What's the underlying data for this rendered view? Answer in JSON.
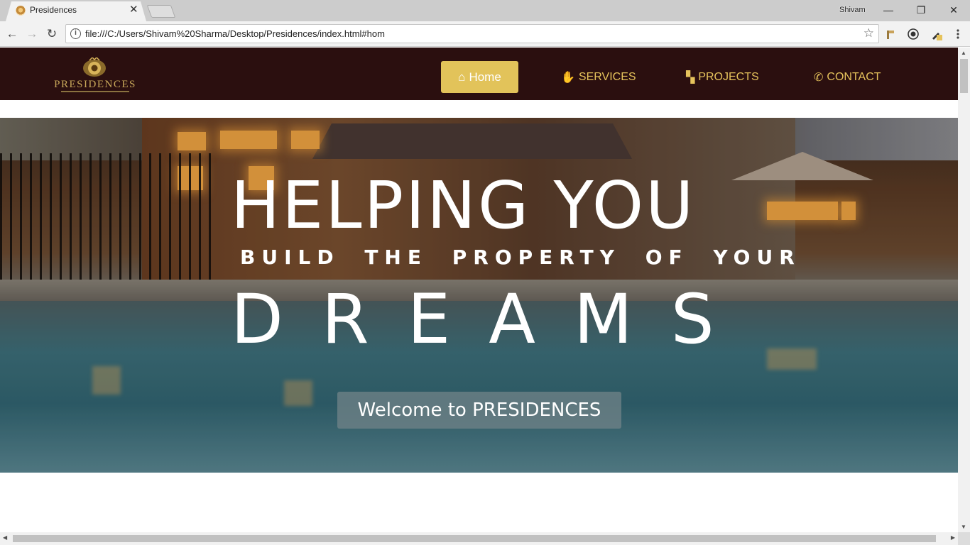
{
  "browser": {
    "tab_title": "Presidences",
    "tab_close": "✕",
    "profile_name": "Shivam",
    "window_controls": {
      "minimize": "—",
      "maximize": "❐",
      "close": "✕"
    },
    "url": "file:///C:/Users/Shivam%20Sharma/Desktop/Presidences/index.html#hom",
    "nav": {
      "back": "←",
      "forward": "→",
      "reload": "↻"
    },
    "bookmark_star": "☆",
    "info_icon": "i"
  },
  "site": {
    "logo_text": "PRESIDENCES",
    "menu": [
      {
        "label": "Home",
        "icon": "home-icon",
        "glyph": "⌂",
        "active": true
      },
      {
        "label": "SERVICES",
        "icon": "handshake-icon",
        "glyph": "✋"
      },
      {
        "label": "PROJECTS",
        "icon": "sitemap-icon",
        "glyph": "▚"
      },
      {
        "label": "CONTACT",
        "icon": "phone-icon",
        "glyph": "✆"
      }
    ],
    "colors": {
      "nav_bg": "#2b0f0f",
      "accent": "#e2c35a",
      "menu_text": "#e6c35c"
    }
  },
  "hero": {
    "line1": "HELPING YOU",
    "line2": "BUILD THE PROPERTY OF YOUR",
    "line3": "DREAMS",
    "button": "Welcome to PRESIDENCES"
  }
}
